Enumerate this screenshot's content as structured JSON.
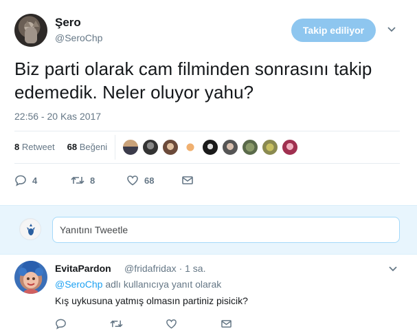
{
  "author": {
    "name": "Şero",
    "handle": "@SeroChp",
    "follow_label": "Takip ediliyor"
  },
  "tweet": {
    "text": "Biz parti olarak cam filminden sonrasını takip edemedik. Neler oluyor yahu?",
    "timestamp": "22:56 - 20 Kas 2017"
  },
  "stats": {
    "retweet_count": "8",
    "retweet_label": "Retweet",
    "like_count": "68",
    "like_label": "Beğeni"
  },
  "actions": {
    "reply_count": "4",
    "retweet_count": "8",
    "like_count": "68"
  },
  "reply_box": {
    "placeholder": "Yanıtını Tweetle"
  },
  "reply": {
    "name": "EvitaPardon",
    "handle": "@fridafridax · 1 sa.",
    "reply_to_handle": "@SeroChp",
    "reply_to_suffix": " adlı kullanıcıya yanıt olarak",
    "text": "Kış uykusuna yatmış olmasın partiniz pisicik?"
  },
  "colors": {
    "accent": "#1da1f2",
    "follow_button": "#8ec6ef",
    "muted": "#657786",
    "reply_bg": "#e8f5fd"
  },
  "icons": [
    "reply-icon",
    "retweet-icon",
    "heart-icon",
    "message-icon",
    "chevron-down-icon"
  ]
}
